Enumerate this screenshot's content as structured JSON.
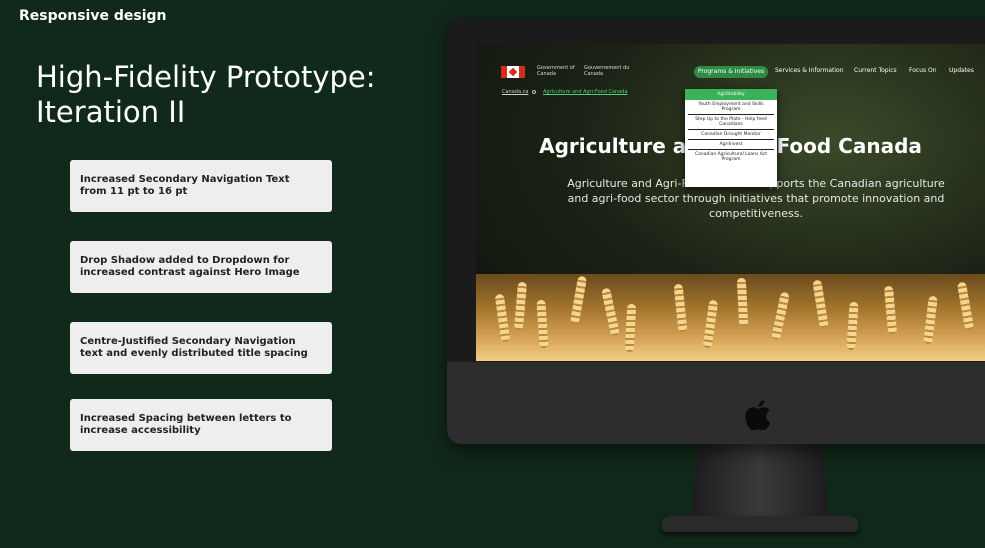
{
  "slide": {
    "label": "Responsive design",
    "title": "High-Fidelity Prototype: Iteration II"
  },
  "notes": [
    {
      "line1": "Increased Secondary Navigation Text",
      "line2": "from 11 pt to 16 pt"
    },
    {
      "line1": "Drop Shadow added to Dropdown for",
      "line2": "increased contrast against Hero Image"
    },
    {
      "line1": "Centre-Justified Secondary Navigation",
      "line2": "text and evenly distributed title spacing"
    },
    {
      "line1": "Increased Spacing between letters to",
      "line2": "increase accessibility"
    }
  ],
  "site": {
    "gov_en": "Government of Canada",
    "gov_fr": "Gouvernement du Canada",
    "nav": {
      "programs": "Programs & Initiatives",
      "services": "Services & Information",
      "topics": "Current Topics",
      "focus": "Focus On",
      "updates": "Updates"
    },
    "breadcrumb": {
      "home": "Canada.ca",
      "current": "Agriculture and Agri-Food Canada"
    },
    "hero": {
      "title": "Agriculture and Agri-Food Canada",
      "description": "Agriculture and Agri-Food Canada supports the Canadian agriculture and agri-food sector through initiatives that promote innovation and competitiveness."
    },
    "dropdown": [
      "AgriStability",
      "Youth Employment and Skills Program",
      "Step Up to the Plate - Help feed Canadians",
      "Canadian Drought Monitor",
      "AgriInvest",
      "Canadian Agricultural Loans Act Program"
    ]
  }
}
